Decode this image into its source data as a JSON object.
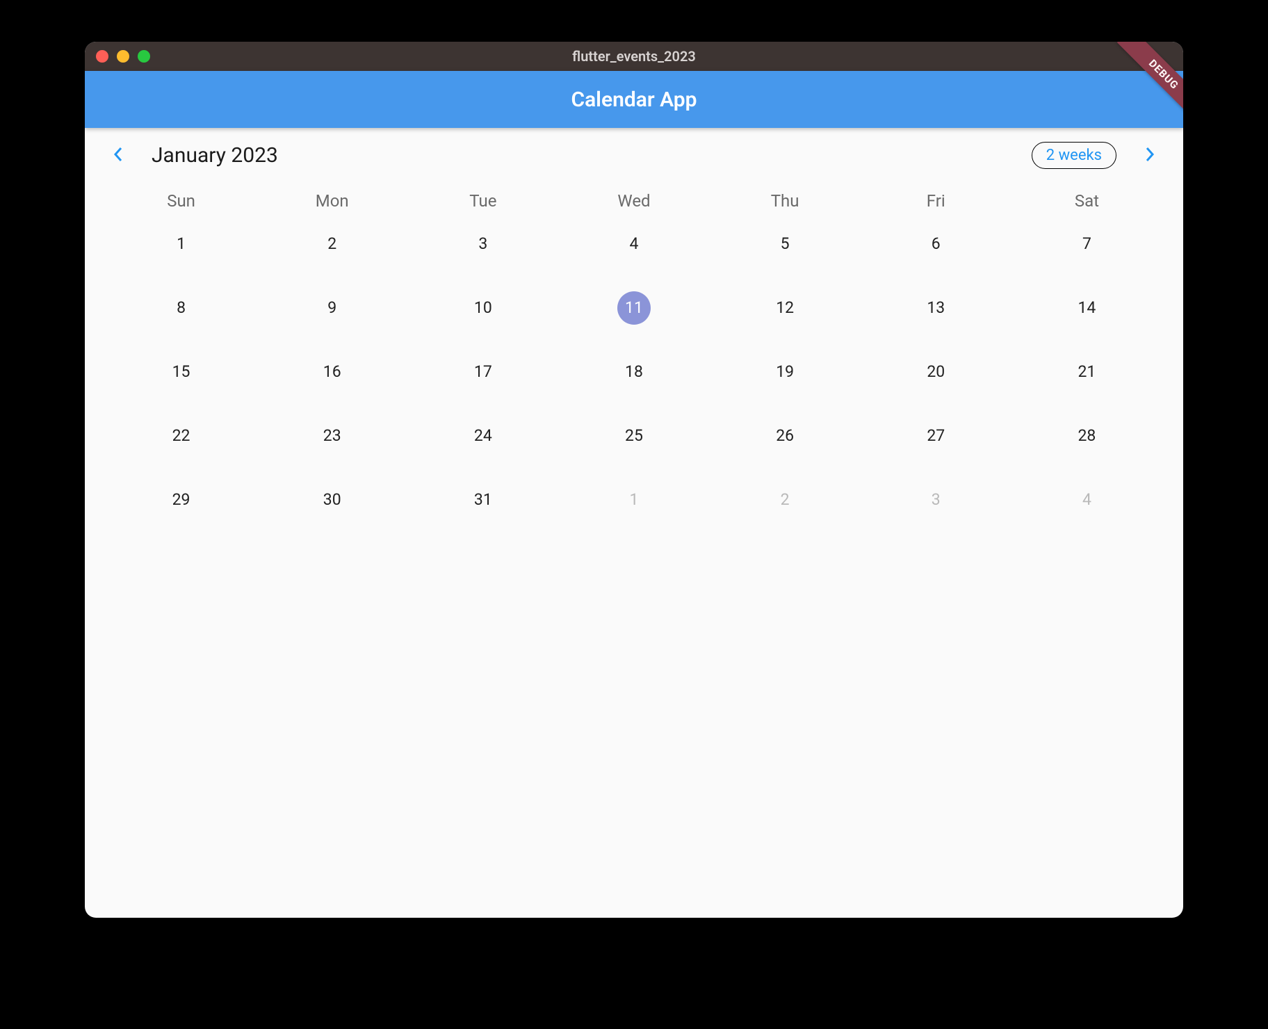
{
  "window": {
    "title": "flutter_events_2023"
  },
  "appbar": {
    "title": "Calendar App",
    "debug_label": "DEBUG"
  },
  "calendar": {
    "month_title": "January 2023",
    "mode_button": "2 weeks",
    "days_of_week": [
      "Sun",
      "Mon",
      "Tue",
      "Wed",
      "Thu",
      "Fri",
      "Sat"
    ],
    "weeks": [
      [
        {
          "d": "1",
          "today": false,
          "outside": false
        },
        {
          "d": "2",
          "today": false,
          "outside": false
        },
        {
          "d": "3",
          "today": false,
          "outside": false
        },
        {
          "d": "4",
          "today": false,
          "outside": false
        },
        {
          "d": "5",
          "today": false,
          "outside": false
        },
        {
          "d": "6",
          "today": false,
          "outside": false
        },
        {
          "d": "7",
          "today": false,
          "outside": false
        }
      ],
      [
        {
          "d": "8",
          "today": false,
          "outside": false
        },
        {
          "d": "9",
          "today": false,
          "outside": false
        },
        {
          "d": "10",
          "today": false,
          "outside": false
        },
        {
          "d": "11",
          "today": true,
          "outside": false
        },
        {
          "d": "12",
          "today": false,
          "outside": false
        },
        {
          "d": "13",
          "today": false,
          "outside": false
        },
        {
          "d": "14",
          "today": false,
          "outside": false
        }
      ],
      [
        {
          "d": "15",
          "today": false,
          "outside": false
        },
        {
          "d": "16",
          "today": false,
          "outside": false
        },
        {
          "d": "17",
          "today": false,
          "outside": false
        },
        {
          "d": "18",
          "today": false,
          "outside": false
        },
        {
          "d": "19",
          "today": false,
          "outside": false
        },
        {
          "d": "20",
          "today": false,
          "outside": false
        },
        {
          "d": "21",
          "today": false,
          "outside": false
        }
      ],
      [
        {
          "d": "22",
          "today": false,
          "outside": false
        },
        {
          "d": "23",
          "today": false,
          "outside": false
        },
        {
          "d": "24",
          "today": false,
          "outside": false
        },
        {
          "d": "25",
          "today": false,
          "outside": false
        },
        {
          "d": "26",
          "today": false,
          "outside": false
        },
        {
          "d": "27",
          "today": false,
          "outside": false
        },
        {
          "d": "28",
          "today": false,
          "outside": false
        }
      ],
      [
        {
          "d": "29",
          "today": false,
          "outside": false
        },
        {
          "d": "30",
          "today": false,
          "outside": false
        },
        {
          "d": "31",
          "today": false,
          "outside": false
        },
        {
          "d": "1",
          "today": false,
          "outside": true
        },
        {
          "d": "2",
          "today": false,
          "outside": true
        },
        {
          "d": "3",
          "today": false,
          "outside": true
        },
        {
          "d": "4",
          "today": false,
          "outside": true
        }
      ]
    ]
  }
}
